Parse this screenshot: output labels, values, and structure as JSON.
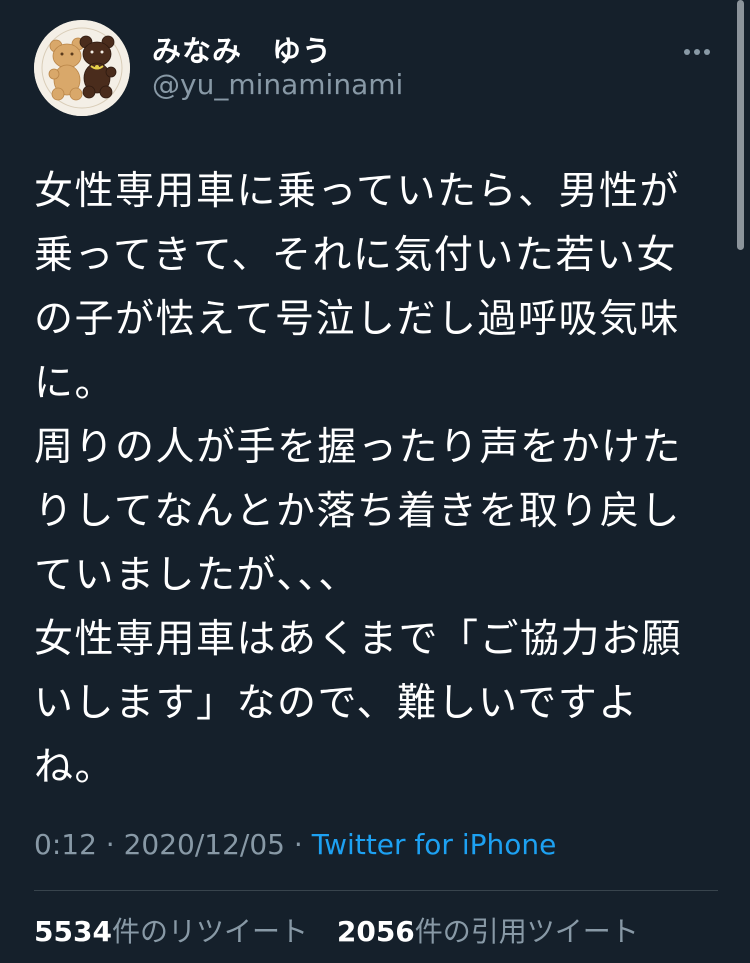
{
  "user": {
    "display_name": "みなみ　ゆう",
    "handle": "@yu_minaminami"
  },
  "icons": {
    "more": "more-horizontal-icon",
    "avatar": "cookie-bears-avatar"
  },
  "tweet": {
    "lines": [
      "女性専用車に乗っていたら、男性が",
      "乗ってきて、それに気付いた若い女",
      "の子が怯えて号泣しだし過呼吸気味",
      "に。",
      "周りの人が手を握ったり声をかけた",
      "りしてなんとか落ち着きを取り戻し",
      "ていましたが、、、",
      "女性専用車はあくまで「ご協力お願",
      "いします」なので、難しいですよ",
      "ね。"
    ]
  },
  "meta": {
    "time": "0:12",
    "separator": " · ",
    "date": "2020/12/05",
    "source": "Twitter for iPhone"
  },
  "stats": {
    "retweets_count": "5534",
    "retweets_label": "件のリツイート",
    "quotes_count": "2056",
    "quotes_label": "件の引用ツイート"
  },
  "colors": {
    "background": "#15202b",
    "text": "#ffffff",
    "secondary": "#8899a6",
    "link": "#1da1f2",
    "divider": "#38444d"
  }
}
